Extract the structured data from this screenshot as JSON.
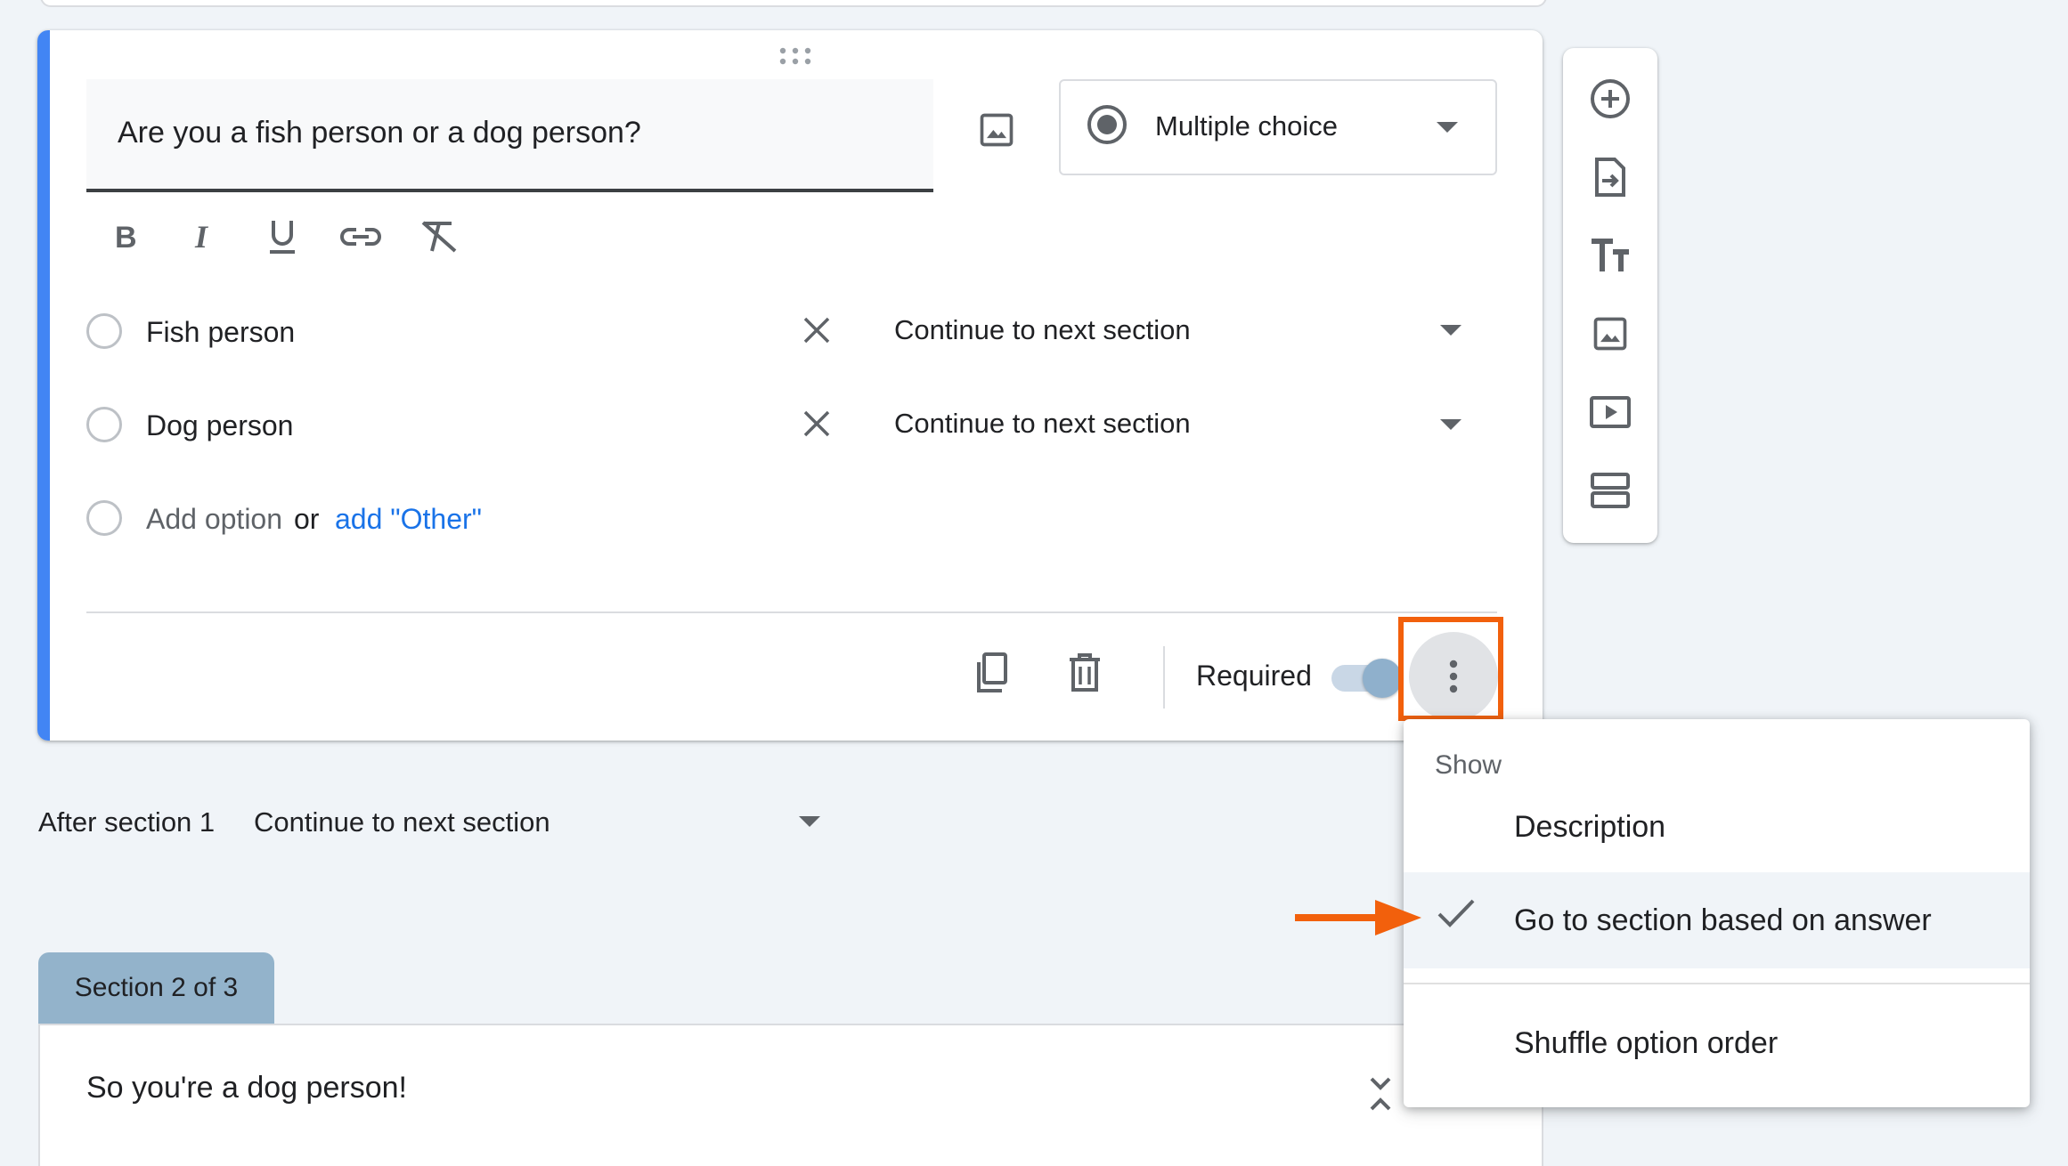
{
  "question": {
    "title": "Are you a fish person or a dog person?",
    "type_label": "Multiple choice",
    "options": [
      {
        "label": "Fish person",
        "goto": "Continue to next section"
      },
      {
        "label": "Dog person",
        "goto": "Continue to next section"
      }
    ],
    "add_option": "Add option",
    "or_text": "or",
    "add_other": "add \"Other\"",
    "required_label": "Required",
    "required_on": true
  },
  "after_section": {
    "label": "After section 1",
    "value": "Continue to next section"
  },
  "section2": {
    "tab_label": "Section 2 of 3",
    "title": "So you're a dog person!"
  },
  "menu": {
    "header": "Show",
    "items": [
      {
        "label": "Description",
        "checked": false
      },
      {
        "label": "Go to section based on answer",
        "checked": true
      },
      {
        "label": "Shuffle option order",
        "checked": false
      }
    ]
  },
  "colors": {
    "accent": "#4285f4",
    "highlight": "#f2600c",
    "link": "#1a73e8",
    "section_tab": "#93b3cb"
  },
  "icons": {
    "toolbar": [
      "add-question-icon",
      "import-questions-icon",
      "add-title-icon",
      "add-image-icon",
      "add-video-icon",
      "add-section-icon"
    ],
    "format": [
      "bold-icon",
      "italic-icon",
      "underline-icon",
      "link-icon",
      "clear-format-icon"
    ],
    "footer": [
      "duplicate-icon",
      "delete-icon",
      "more-options-icon"
    ]
  }
}
